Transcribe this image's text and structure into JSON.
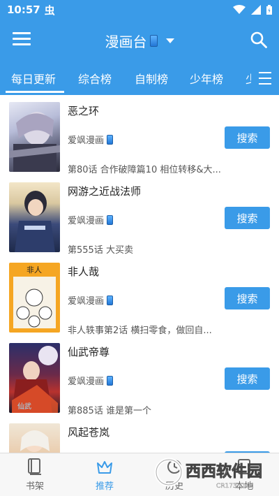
{
  "status": {
    "time": "10:57",
    "notif": "虫"
  },
  "header": {
    "title": "漫画台",
    "title_icon": "phone-icon"
  },
  "tabs": [
    {
      "label": "每日更新",
      "active": true
    },
    {
      "label": "综合榜",
      "active": false
    },
    {
      "label": "自制榜",
      "active": false
    },
    {
      "label": "少年榜",
      "active": false
    },
    {
      "label": "少",
      "active": false
    }
  ],
  "list": [
    {
      "title": "恶之环",
      "source": "爱飒漫画",
      "chapter": "第80话 合作破障篇10 相位转移&大...",
      "button": "搜索",
      "cover_colors": [
        "#cfd4e8",
        "#6b6e88",
        "#2a2a3a"
      ]
    },
    {
      "title": "网游之近战法师",
      "source": "爱飒漫画",
      "chapter": "第555话 大买卖",
      "button": "搜索",
      "cover_colors": [
        "#e8d8b8",
        "#3b4a7a",
        "#1e2a4a"
      ]
    },
    {
      "title": "非人哉",
      "source": "爱飒漫画",
      "chapter": "非人轶事第2话 横扫零食，做回自...",
      "button": "搜索",
      "cover_colors": [
        "#f5a623",
        "#f5f0e0",
        "#e8892a"
      ]
    },
    {
      "title": "仙武帝尊",
      "source": "爱飒漫画",
      "chapter": "第885话 谁是第一个",
      "button": "搜索",
      "cover_colors": [
        "#2b2f6a",
        "#b8322e",
        "#1a1a2a"
      ]
    },
    {
      "title": "风起苍岚",
      "source": "",
      "chapter": "",
      "button": "搜索",
      "cover_colors": [
        "#f0e6d6",
        "#c83a3a",
        "#e9c9a8"
      ]
    }
  ],
  "bottom_nav": [
    {
      "label": "书架",
      "icon": "bookshelf-icon",
      "active": false
    },
    {
      "label": "推荐",
      "icon": "crown-icon",
      "active": true
    },
    {
      "label": "历史",
      "icon": "history-icon",
      "active": false
    },
    {
      "label": "本地",
      "icon": "local-icon",
      "active": false
    }
  ],
  "watermark": {
    "text": "西西软件园",
    "sub": "CR173.COM"
  },
  "colors": {
    "primary": "#3a9be8"
  }
}
